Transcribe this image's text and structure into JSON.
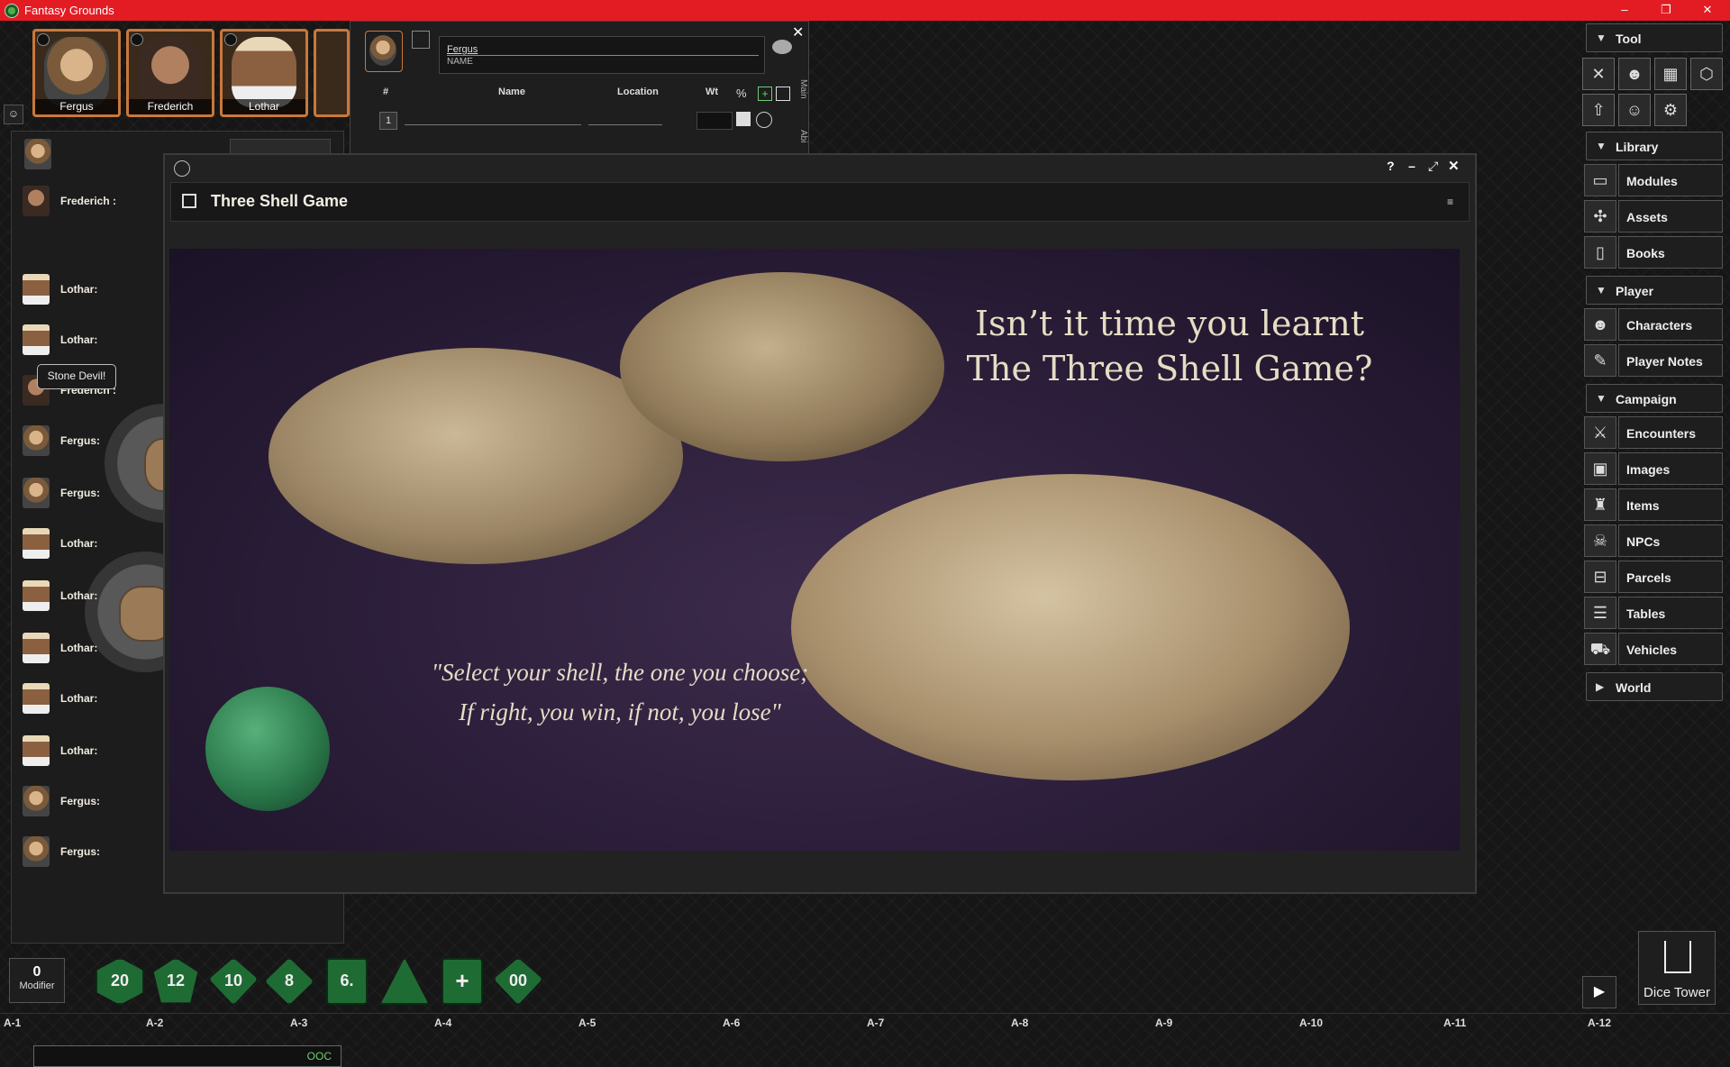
{
  "window": {
    "title": "Fantasy Grounds",
    "controls": [
      "–",
      "❐",
      "✕"
    ]
  },
  "portraits": [
    "Fergus",
    "Frederich",
    "Lothar"
  ],
  "chat": {
    "messages": [
      {
        "speaker": "Frederich :",
        "avatar": "frederich"
      },
      {
        "speaker": "Lothar:",
        "avatar": "lothar"
      },
      {
        "speaker": "Lothar:",
        "avatar": "lothar"
      },
      {
        "speaker": "Frederich :",
        "avatar": "frederich"
      },
      {
        "speaker": "Fergus:",
        "avatar": "fergus"
      },
      {
        "speaker": "Fergus:",
        "avatar": "fergus"
      },
      {
        "speaker": "Lothar:",
        "avatar": "lothar"
      },
      {
        "speaker": "Lothar:",
        "avatar": "lothar"
      },
      {
        "speaker": "Lothar:",
        "avatar": "lothar"
      },
      {
        "speaker": "Lothar:",
        "avatar": "lothar"
      },
      {
        "speaker": "Lothar:",
        "avatar": "lothar"
      },
      {
        "speaker": "Fergus:",
        "avatar": "fergus"
      },
      {
        "speaker": "Fergus:",
        "avatar": "fergus"
      }
    ],
    "stone_devil": "Stone Devil!",
    "mode": "OOC"
  },
  "inventory": {
    "character_name": "Fergus",
    "name_label": "NAME",
    "columns": {
      "num": "#",
      "name": "Name",
      "location": "Location",
      "weight": "Wt"
    },
    "row_number": "1",
    "side_tabs": [
      "Main",
      "Abi"
    ]
  },
  "image_window": {
    "title": "Three Shell Game",
    "headline": [
      "Isn’t it time you learnt",
      "The Three Shell Game?"
    ],
    "poem": [
      "\"Select your shell, the one you choose;",
      "If right, you win, if not, you lose\""
    ]
  },
  "sidebar": {
    "tool_label": "Tool",
    "library": {
      "label": "Library",
      "items": [
        "Modules",
        "Assets",
        "Books"
      ]
    },
    "player": {
      "label": "Player",
      "items": [
        "Characters",
        "Player Notes"
      ]
    },
    "campaign": {
      "label": "Campaign",
      "items": [
        "Encounters",
        "Images",
        "Items",
        "NPCs",
        "Parcels",
        "Tables",
        "Vehicles"
      ]
    },
    "world_label": "World"
  },
  "dice_bar": {
    "modifier_value": "0",
    "modifier_label": "Modifier",
    "dice": [
      "20",
      "12",
      "10",
      "8",
      "6.",
      "4",
      "+",
      "00"
    ],
    "dice_tower_label": "Dice Tower"
  },
  "grid_labels": [
    "A-1",
    "A-2",
    "A-3",
    "A-4",
    "A-5",
    "A-6",
    "A-7",
    "A-8",
    "A-9",
    "A-10",
    "A-11",
    "A-12"
  ],
  "colors": {
    "titlebar": "#e31c24",
    "dice": "#1f6b34",
    "portrait_border": "#c9783a"
  }
}
